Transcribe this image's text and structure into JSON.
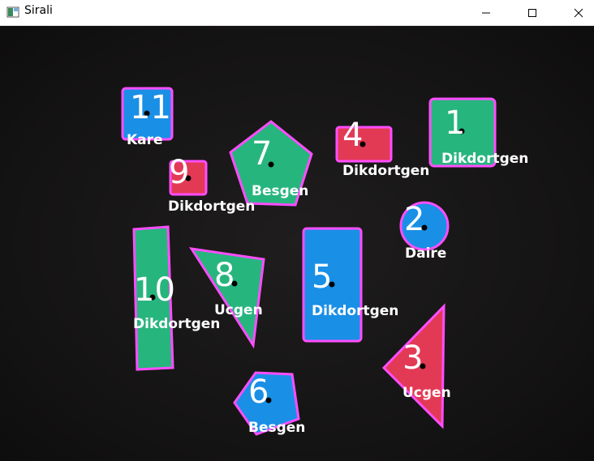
{
  "window": {
    "title": "Sirali",
    "icon": "app-window-icon",
    "controls": [
      "minimize-icon",
      "maximize-icon",
      "close-icon"
    ]
  },
  "colors": {
    "green": "#27b57e",
    "red": "#e23a55",
    "blue": "#1a8fe6",
    "outline": "#ff4dff",
    "background": "#151414",
    "label": "#ffffff",
    "center_dot": "#000000"
  },
  "shapes": [
    {
      "id": "1",
      "number": "1",
      "type": "Dikdortgen",
      "color": "green"
    },
    {
      "id": "2",
      "number": "2",
      "type": "Daire",
      "color": "blue"
    },
    {
      "id": "3",
      "number": "3",
      "type": "Ucgen",
      "color": "red"
    },
    {
      "id": "4",
      "number": "4",
      "type": "Dikdortgen",
      "color": "red"
    },
    {
      "id": "5",
      "number": "5",
      "type": "Dikdortgen",
      "color": "blue"
    },
    {
      "id": "6",
      "number": "6",
      "type": "Besgen",
      "color": "blue"
    },
    {
      "id": "7",
      "number": "7",
      "type": "Besgen",
      "color": "green"
    },
    {
      "id": "8",
      "number": "8",
      "type": "Ucgen",
      "color": "green"
    },
    {
      "id": "9",
      "number": "9",
      "type": "Dikdortgen",
      "color": "red"
    },
    {
      "id": "10",
      "number": "10",
      "type": "Dikdortgen",
      "color": "green"
    },
    {
      "id": "11",
      "number": "11",
      "type": "Kare",
      "color": "blue"
    }
  ]
}
